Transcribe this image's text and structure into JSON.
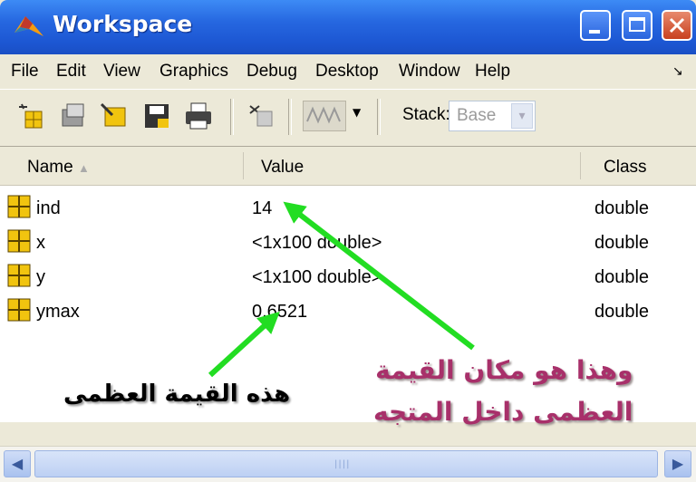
{
  "window": {
    "title": "Workspace"
  },
  "menu": [
    "File",
    "Edit",
    "View",
    "Graphics",
    "Debug",
    "Desktop",
    "Window",
    "Help"
  ],
  "toolbar": {
    "tools": [
      "new-variable-icon",
      "open-variable-icon",
      "import-data-icon",
      "save-icon",
      "print-icon",
      "delete-icon",
      "plot-icon",
      "plot-dropdown-icon"
    ],
    "stack_label": "Stack:",
    "stack_value": "Base"
  },
  "columns": {
    "name": "Name",
    "value": "Value",
    "class": "Class"
  },
  "variables": [
    {
      "name": "ind",
      "value": "14",
      "class": "double"
    },
    {
      "name": "x",
      "value": "<1x100 double>",
      "class": "double"
    },
    {
      "name": "y",
      "value": "<1x100 double>",
      "class": "double"
    },
    {
      "name": "ymax",
      "value": "0.6521",
      "class": "double"
    }
  ],
  "annotations": {
    "max_location_line1": "وهذا هو مكان القيمة",
    "max_location_line2": "العظمى داخل المتجه",
    "max_value": "هذه القيمة العظمى"
  },
  "colors": {
    "titlebar": "#2667e0",
    "arrow": "#22dd22",
    "annotation_text": "#a8306a",
    "var_icon": "#f1c40f"
  }
}
